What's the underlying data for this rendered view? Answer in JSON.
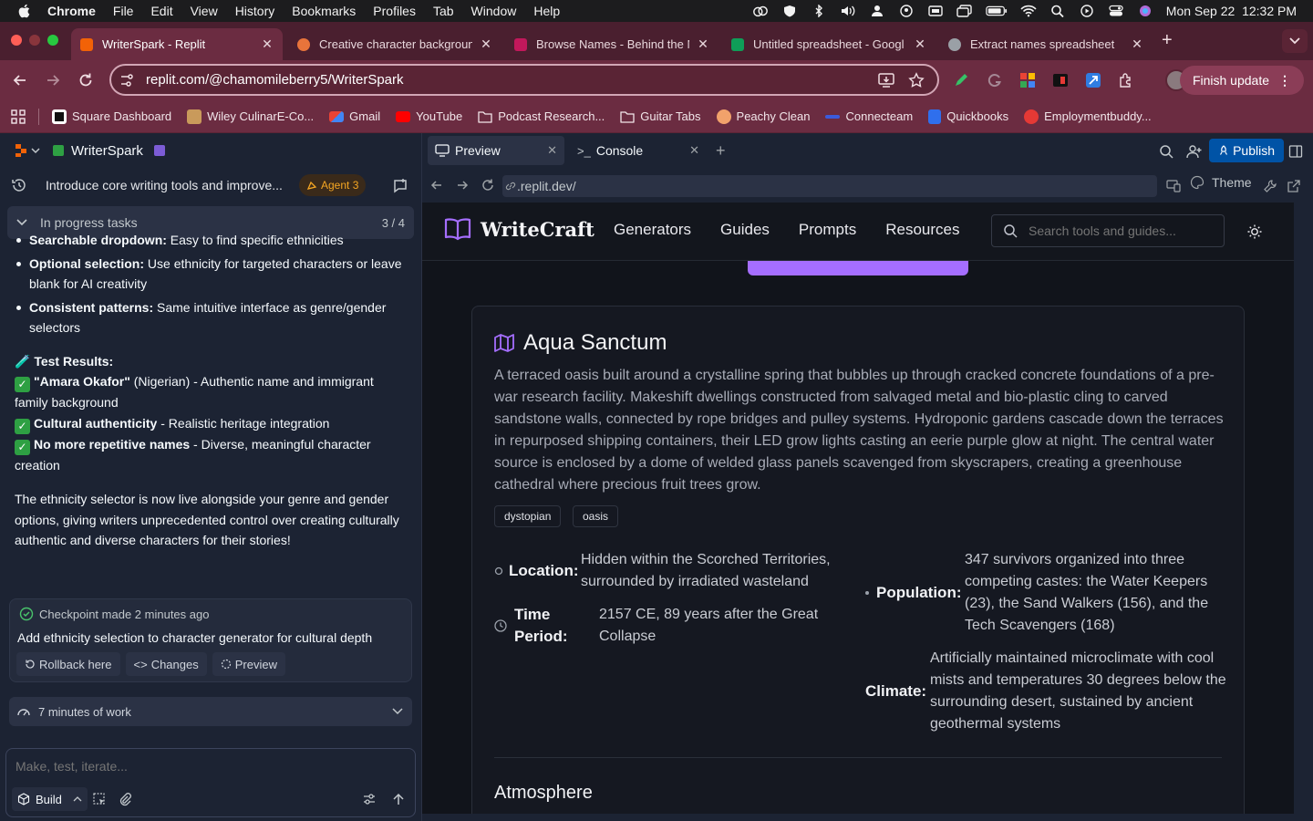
{
  "menubar": {
    "app": "Chrome",
    "items": [
      "File",
      "Edit",
      "View",
      "History",
      "Bookmarks",
      "Profiles",
      "Tab",
      "Window",
      "Help"
    ],
    "datetime": "Mon Sep 22  12:32 PM"
  },
  "tabs": [
    {
      "title": "WriterSpark - Replit",
      "color": "#f26207"
    },
    {
      "title": "Creative character backgroun",
      "color": "#e8743b"
    },
    {
      "title": "Browse Names - Behind the N",
      "color": "#c2185b"
    },
    {
      "title": "Untitled spreadsheet - Googl",
      "color": "#0f9d58"
    },
    {
      "title": "Extract names spreadsheet",
      "color": "#9aa0a6"
    }
  ],
  "address": {
    "url": "replit.com/@chamomileberry5/WriterSpark",
    "finish_update": "Finish update"
  },
  "bookmarks": [
    {
      "label": "Square Dashboard",
      "color": "#ffffff"
    },
    {
      "label": "Wiley CulinarE-Co...",
      "color": "#c99a5b"
    },
    {
      "label": "Gmail",
      "color": "#ea4335"
    },
    {
      "label": "YouTube",
      "color": "#ff0000"
    },
    {
      "label": "Podcast Research...",
      "color": "folder"
    },
    {
      "label": "Guitar Tabs",
      "color": "folder"
    },
    {
      "label": "Peachy Clean",
      "color": "#f1a26b"
    },
    {
      "label": "Connecteam",
      "color": "#3b5bdb"
    },
    {
      "label": "Quickbooks",
      "color": "#2f6fed"
    },
    {
      "label": "Employmentbuddy...",
      "color": "#e53935"
    }
  ],
  "replit": {
    "project": "WriterSpark",
    "thread_title": "Introduce core writing tools and improve...",
    "agent_badge": "Agent 3",
    "progress_label": "In progress tasks",
    "progress_count": "3 / 4",
    "bullets": [
      {
        "bold": "Searchable dropdown:",
        "text": " Easy to find specific ethnicities"
      },
      {
        "bold": "Optional selection:",
        "text": " Use ethnicity for targeted characters or leave blank for AI creativity"
      },
      {
        "bold": "Consistent patterns:",
        "text": " Same intuitive interface as genre/gender selectors"
      }
    ],
    "test_heading": "Test Results:",
    "tests": [
      {
        "bold": "\"Amara Okafor\"",
        "text": " (Nigerian) - Authentic name and immigrant family background"
      },
      {
        "bold": "Cultural authenticity",
        "text": " - Realistic heritage integration"
      },
      {
        "bold": "No more repetitive names",
        "text": " - Diverse, meaningful character creation"
      }
    ],
    "summary": "The ethnicity selector is now live alongside your genre and gender options, giving writers unprecedented control over creating culturally authentic and diverse characters for their stories!",
    "checkpoint": {
      "label": "Checkpoint made",
      "time": "2 minutes ago",
      "message": "Add ethnicity selection to character generator for cultural depth",
      "rollback": "Rollback here",
      "changes": "Changes",
      "preview": "Preview"
    },
    "work_time": "7 minutes of work",
    "composer_placeholder": "Make, test, iterate...",
    "build": "Build"
  },
  "panel": {
    "tab_preview": "Preview",
    "tab_console": "Console",
    "publish": "Publish",
    "url": ".replit.dev/",
    "theme": "Theme"
  },
  "site": {
    "logo": "WriteCraft",
    "nav": [
      "Generators",
      "Guides",
      "Prompts",
      "Resources"
    ],
    "search_placeholder": "Search tools and guides...",
    "place": {
      "name": "Aqua Sanctum",
      "description": "A terraced oasis built around a crystalline spring that bubbles up through cracked concrete foundations of a pre-war research facility. Makeshift dwellings constructed from salvaged metal and bio-plastic cling to carved sandstone walls, connected by rope bridges and pulley systems. Hydroponic gardens cascade down the terraces in repurposed shipping containers, their LED grow lights casting an eerie purple glow at night. The central water source is enclosed by a dome of welded glass panels scavenged from skyscrapers, creating a greenhouse cathedral where precious fruit trees grow.",
      "tags": [
        "dystopian",
        "oasis"
      ],
      "location_label": "Location:",
      "location": "Hidden within the Scorched Territories, surrounded by irradiated wasteland",
      "time_label": "Time Period:",
      "time": "2157 CE, 89 years after the Great Collapse",
      "population_label": "Population:",
      "population": "347 survivors organized into three competing castes: the Water Keepers (23), the Sand Walkers (156), and the Tech Scavengers (168)",
      "climate_label": "Climate:",
      "climate": "Artificially maintained microclimate with cool mists and temperatures 30 degrees below the surrounding desert, sustained by ancient geothermal systems",
      "atmosphere": "Atmosphere"
    }
  }
}
